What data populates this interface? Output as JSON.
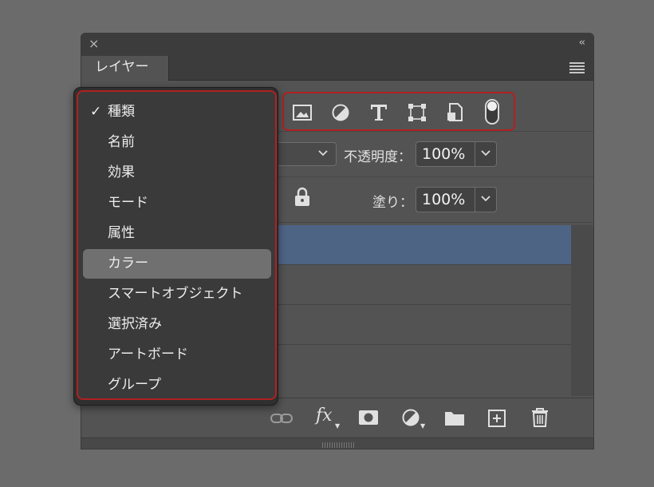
{
  "panel": {
    "tab_label": "レイヤー",
    "close_glyph": "×",
    "collapse_glyph": "‹‹"
  },
  "filter_menu": {
    "items": [
      {
        "label": "種類",
        "checked": true
      },
      {
        "label": "名前",
        "checked": false
      },
      {
        "label": "効果",
        "checked": false
      },
      {
        "label": "モード",
        "checked": false
      },
      {
        "label": "属性",
        "checked": false
      },
      {
        "label": "カラー",
        "checked": false,
        "highlighted": true
      },
      {
        "label": "スマートオブジェクト",
        "checked": false
      },
      {
        "label": "選択済み",
        "checked": false
      },
      {
        "label": "アートボード",
        "checked": false
      },
      {
        "label": "グループ",
        "checked": false
      }
    ],
    "check_glyph": "✓",
    "highlight_color": "#707070",
    "outline_color": "#b02121"
  },
  "filter_icons": [
    "image-filter-icon",
    "adjustment-filter-icon",
    "type-filter-icon",
    "shape-filter-icon",
    "smart-object-filter-icon",
    "filter-toggle-switch"
  ],
  "opacity": {
    "label": "不透明度：",
    "value": "100%"
  },
  "fill": {
    "label": "塗り：",
    "value": "100%"
  },
  "layers": {
    "selected_color": "#4e6485",
    "row_count": 4
  },
  "toolbar_icons": [
    "link-icon",
    "fx-icon",
    "mask-icon",
    "adjustment-icon",
    "folder-icon",
    "new-layer-icon",
    "trash-icon"
  ],
  "toolbar": {
    "fx_label": "fx"
  }
}
